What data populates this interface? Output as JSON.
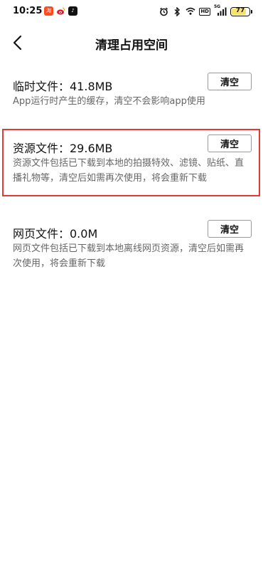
{
  "status_bar": {
    "time": "10:25",
    "battery_level": "77",
    "network_label": "HD",
    "signal_label": "5G",
    "apps": [
      {
        "name": "taobao",
        "glyph": "淘"
      },
      {
        "name": "weibo",
        "glyph": ""
      },
      {
        "name": "tiktok",
        "glyph": "♪"
      }
    ]
  },
  "header": {
    "title": "清理占用空间"
  },
  "sections": [
    {
      "title": "临时文件：41.8MB",
      "description": "App运行时产生的缓存，清空不会影响app使用",
      "button_label": "清空",
      "highlighted": false
    },
    {
      "title": "资源文件：29.6MB",
      "description": "资源文件包括已下载到本地的拍摄特效、滤镜、贴纸、直播礼物等，清空后如需再次使用，将会重新下载",
      "button_label": "清空",
      "highlighted": true
    },
    {
      "title": "网页文件：0.0M",
      "description": "网页文件包括已下载到本地离线网页资源，清空后如需再次使用，将会重新下载",
      "button_label": "清空",
      "highlighted": false
    }
  ],
  "colors": {
    "highlight_border": "#e53935",
    "description_text": "#666666",
    "battery_fill": "#f7e36a"
  }
}
